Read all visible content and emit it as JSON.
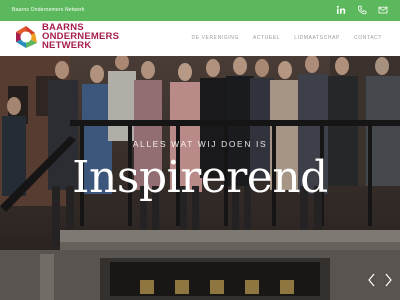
{
  "topbar": {
    "tagline": "Baarns Ondernemers Netwerk",
    "icons": [
      "linkedin-icon",
      "phone-icon",
      "mail-icon"
    ],
    "color": "#5cb85c"
  },
  "logo": {
    "line1": "BAARNS",
    "line2": "ONDERNEMERS",
    "line3": "NETWERK",
    "color": "#a61e4d"
  },
  "nav": {
    "items": [
      {
        "label": "DE VERENIGING"
      },
      {
        "label": "ACTUEEL"
      },
      {
        "label": "LIDMAATSCHAP"
      },
      {
        "label": "CONTACT"
      }
    ]
  },
  "hero": {
    "subtitle": "ALLES WAT WIJ DOEN IS",
    "title": "Inspirerend",
    "arrows": [
      "chevron-left-icon",
      "chevron-right-icon"
    ]
  }
}
